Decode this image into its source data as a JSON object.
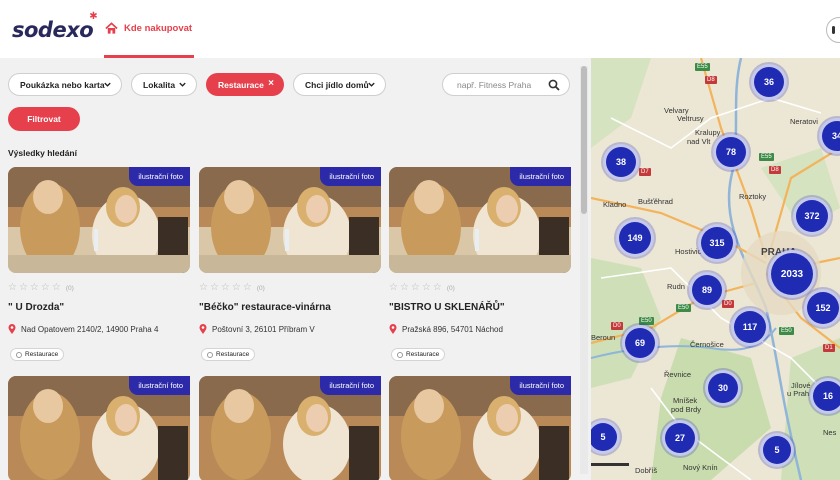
{
  "header": {
    "logo_text": "sodexo",
    "nav_tab_label": "Kde nakupovat",
    "accent_color": "#e5404c",
    "brand_color": "#2a295c"
  },
  "filters": {
    "voucher_label": "Poukázka nebo karta",
    "location_label": "Lokalita",
    "category_label": "Restaurace",
    "category_remove": "×",
    "food_label": "Chci jídlo domů",
    "search_placeholder": "např. Fitness Praha",
    "filter_button": "Filtrovat"
  },
  "results": {
    "title": "Výsledky hledání",
    "cards": [
      {
        "badge": "ilustrační foto",
        "stars": "☆☆☆☆☆",
        "rating_count": "(0)",
        "name": "\" U Drozda\"",
        "address": "Nad Opatovem 2140/2, 14900 Praha 4",
        "tag": "Restaurace"
      },
      {
        "badge": "ilustrační foto",
        "stars": "☆☆☆☆☆",
        "rating_count": "(0)",
        "name": "\"Béčko\" restaurace-vinárna",
        "address": "Poštovní 3, 26101 Příbram V",
        "tag": "Restaurace"
      },
      {
        "badge": "ilustrační foto",
        "stars": "☆☆☆☆☆",
        "rating_count": "(0)",
        "name": "\"BISTRO U SKLENÁŘŮ\"",
        "address": "Pražská 896, 54701 Náchod",
        "tag": "Restaurace"
      },
      {
        "badge": "ilustrační foto"
      },
      {
        "badge": "ilustrační foto"
      },
      {
        "badge": "ilustrační foto"
      }
    ]
  },
  "map": {
    "clusters": [
      "36",
      "34",
      "38",
      "78",
      "372",
      "149",
      "315",
      "2033",
      "89",
      "152",
      "117",
      "69",
      "30",
      "16",
      "5",
      "27",
      "5"
    ],
    "labels": [
      "Velvary",
      "Veltrusy",
      "Kralupy",
      "nad Vlt",
      "Neratovi",
      "Bušťěhrad",
      "Kladno",
      "Roztoky",
      "Hostivice",
      "PRAHA",
      "Rudn",
      "Beroun",
      "Černošice",
      "Řevnice",
      "Jílové",
      "u Prah",
      "Mníšek",
      "pod Brdy",
      "Dobříš",
      "Nový Knín",
      "Nes",
      "E55",
      "D8",
      "D7",
      "E55",
      "D8",
      "E50",
      "D0",
      "D0",
      "E50",
      "E50",
      "D1"
    ],
    "cluster_color": "#1f2bb3"
  }
}
